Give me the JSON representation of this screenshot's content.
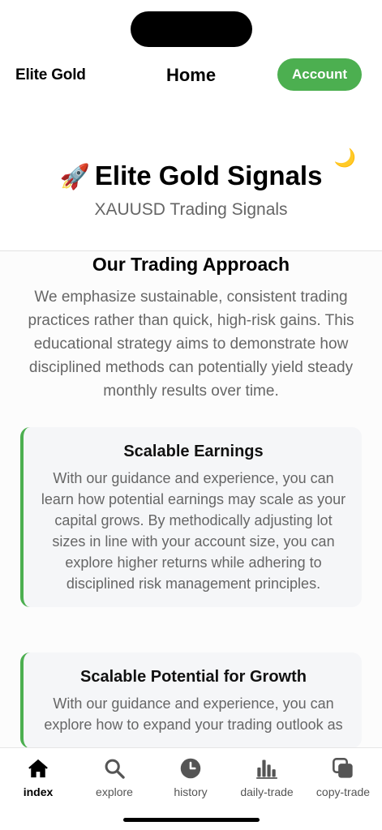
{
  "header": {
    "brand": "Elite Gold",
    "title": "Home",
    "account_label": "Account"
  },
  "hero": {
    "theme_icon": "🌙",
    "rocket_icon": "🚀",
    "title": "Elite Gold Signals",
    "subtitle": "XAUUSD Trading Signals"
  },
  "approach": {
    "title": "Our Trading Approach",
    "text": "We emphasize sustainable, consistent trading practices rather than quick, high-risk gains. This educational strategy aims to demonstrate how disciplined methods can potentially yield steady monthly results over time."
  },
  "cards": [
    {
      "title": "Scalable Earnings",
      "text": "With our guidance and experience, you can learn how potential earnings may scale as your capital grows. By methodically adjusting lot sizes in line with your account size, you can explore higher returns while adhering to disciplined risk management principles."
    },
    {
      "title": "Scalable Potential for Growth",
      "text": "With our guidance and experience, you can explore how to expand your trading outlook as"
    }
  ],
  "tabs": [
    {
      "label": "index",
      "icon": "home-icon",
      "active": true
    },
    {
      "label": "explore",
      "icon": "search-icon",
      "active": false
    },
    {
      "label": "history",
      "icon": "clock-icon",
      "active": false
    },
    {
      "label": "daily-trade",
      "icon": "bar-chart-icon",
      "active": false
    },
    {
      "label": "copy-trade",
      "icon": "copy-icon",
      "active": false
    }
  ],
  "colors": {
    "accent": "#4caf50",
    "muted_text": "#666666",
    "card_bg": "#f5f6f8"
  }
}
